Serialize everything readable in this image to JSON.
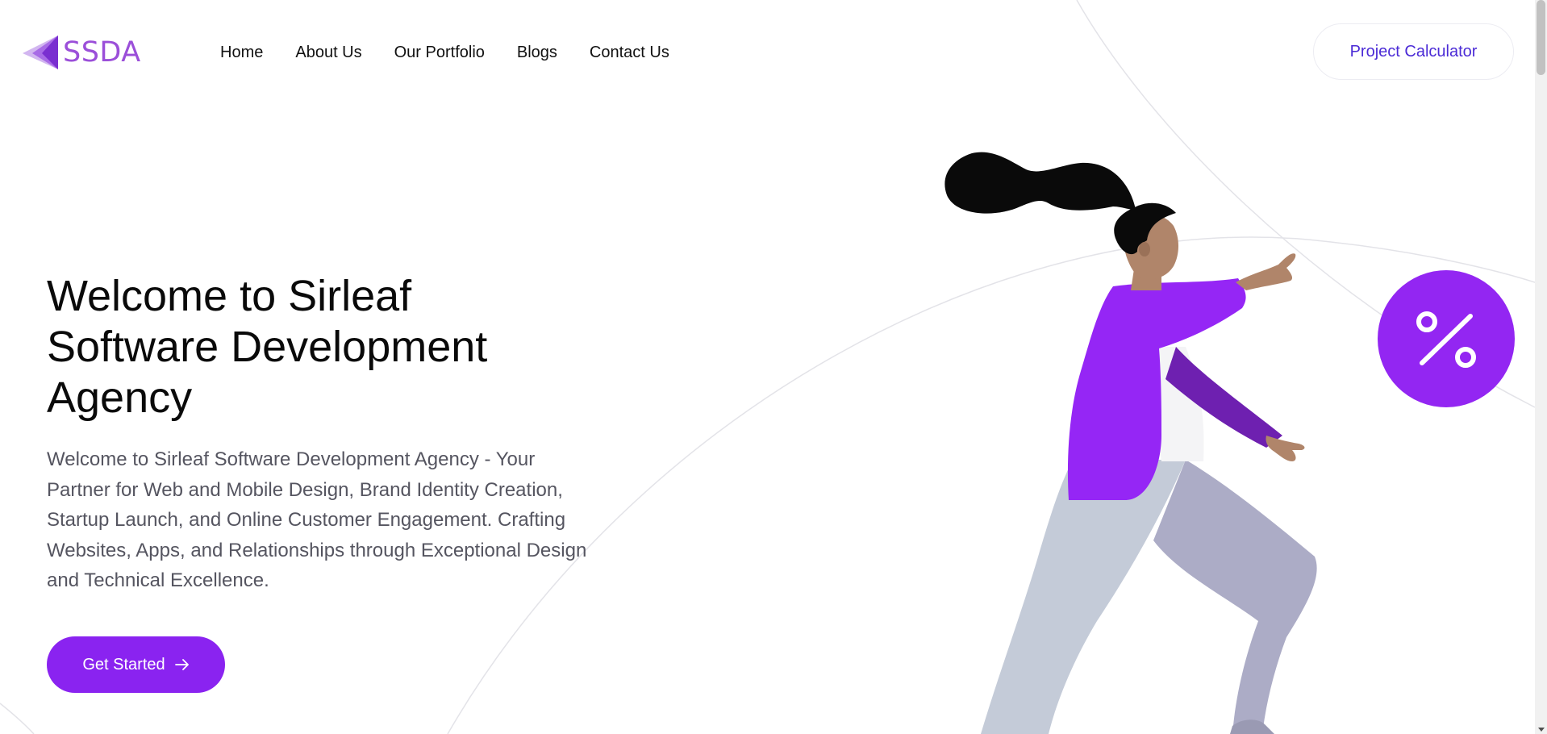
{
  "header": {
    "logo_text": "SSDA",
    "nav": [
      {
        "label": "Home"
      },
      {
        "label": "About Us"
      },
      {
        "label": "Our Portfolio"
      },
      {
        "label": "Blogs"
      },
      {
        "label": "Contact Us"
      }
    ],
    "calculator_label": "Project Calculator"
  },
  "hero": {
    "title": "Welcome to Sirleaf Software Development Agency",
    "description": "Welcome to Sirleaf Software Development Agency - Your Partner for Web and Mobile Design, Brand Identity Creation, Startup Launch, and Online Customer Engagement. Crafting Websites, Apps, and Relationships through Exceptional Design and Technical Excellence.",
    "cta_label": "Get Started"
  },
  "colors": {
    "brand_purple": "#8a23f0",
    "logo_purple": "#9b4fd9",
    "calculator_text": "#4b2bd6",
    "badge_purple": "#9326f2"
  },
  "icons": {
    "logo": "ssda-logo-icon",
    "cta_arrow": "arrow-right-icon",
    "percent_badge": "percent-icon"
  }
}
